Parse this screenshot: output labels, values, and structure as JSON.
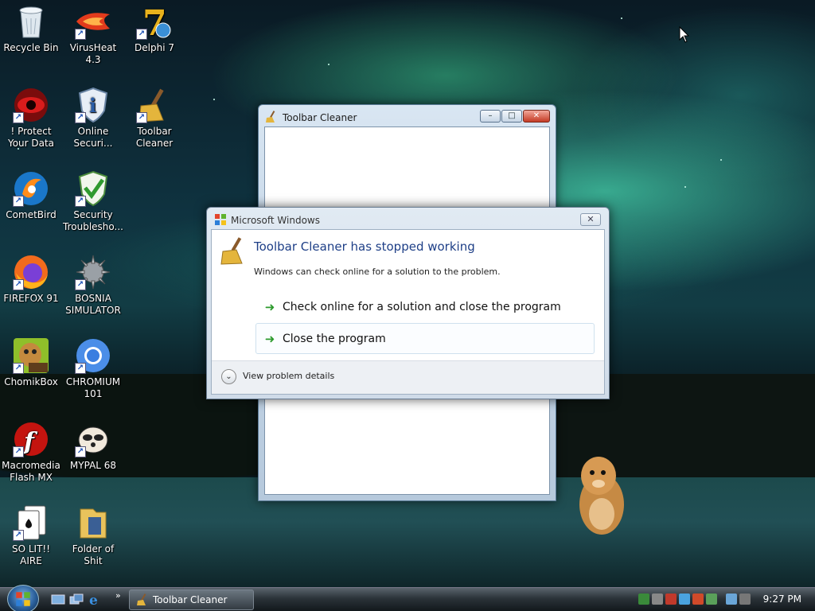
{
  "desktop": {
    "icons": [
      {
        "label": "Recycle Bin",
        "icon": "recycle-bin-icon"
      },
      {
        "label": "VirusHeat 4.3",
        "icon": "virusheat-icon"
      },
      {
        "label": "Delphi 7",
        "icon": "delphi-icon"
      },
      {
        "label": "! Protect Your Data",
        "icon": "protect-data-icon"
      },
      {
        "label": "Online Securi...",
        "icon": "shield-info-icon"
      },
      {
        "label": "Toolbar Cleaner",
        "icon": "broom-icon"
      },
      {
        "label": "CometBird",
        "icon": "cometbird-icon"
      },
      {
        "label": "Security Troublesho...",
        "icon": "shield-check-icon"
      },
      {
        "label": "FIREFOX 91",
        "icon": "firefox-icon"
      },
      {
        "label": "BOSNIA SIMULATOR",
        "icon": "spiked-ball-icon"
      },
      {
        "label": "ChomikBox",
        "icon": "chomikbox-icon"
      },
      {
        "label": "CHROMIUM 101",
        "icon": "chromium-icon"
      },
      {
        "label": "Macromedia Flash MX",
        "icon": "flash-icon"
      },
      {
        "label": "MYPAL 68",
        "icon": "raccoon-icon"
      },
      {
        "label": "SO LIT!! AIRE",
        "icon": "cards-icon"
      },
      {
        "label": "Folder of Shit",
        "icon": "folder-icon"
      }
    ]
  },
  "app_window": {
    "title": "Toolbar Cleaner",
    "buttons": {
      "minimize": "–",
      "maximize": "□",
      "close": "✕"
    }
  },
  "error_dialog": {
    "window_title": "Microsoft Windows",
    "heading": "Toolbar Cleaner has stopped working",
    "subtext": "Windows can check online for a solution to the problem.",
    "options": [
      "Check online for a solution and close the program",
      "Close the program"
    ],
    "details_label": "View problem details"
  },
  "taskbar": {
    "task_label": "Toolbar Cleaner",
    "overflow": "»",
    "clock": "9:27 PM"
  }
}
